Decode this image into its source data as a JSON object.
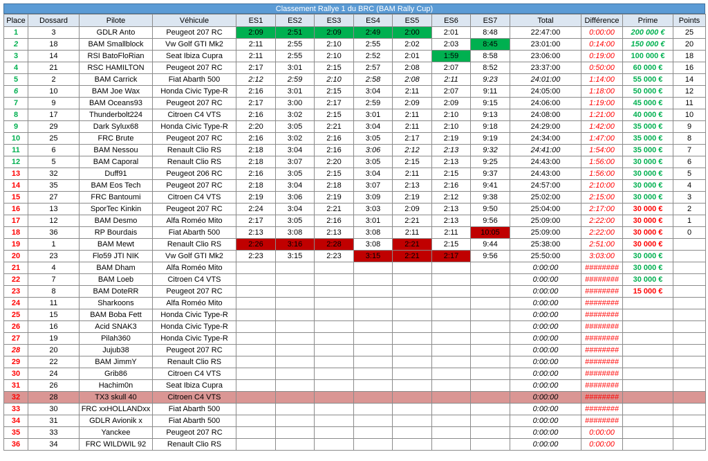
{
  "title": "Classement Rallye 1 du BRC (BAM Rally Cup)",
  "headers": [
    "Place",
    "Dossard",
    "Pilote",
    "Véhicule",
    "ES1",
    "ES2",
    "ES3",
    "ES4",
    "ES5",
    "ES6",
    "ES7",
    "Total",
    "Différence",
    "Prime",
    "Points"
  ],
  "colors": {
    "header_bg": "#dce6f1",
    "title_bg": "#5b9bd5",
    "best_green": "#00b050",
    "worst_red": "#c00000",
    "highlight_row": "#da9694",
    "place_green": "#00b050",
    "place_red": "#ff0000",
    "prime_green": "#00b050",
    "prime_red": "#ff0000"
  },
  "rows": [
    [
      "1",
      "3",
      "GDLR Anto",
      "Peugeot 207 RC",
      "2:09",
      "2:51",
      "2:09",
      "2:49",
      "2:00",
      "2:01",
      "8:48",
      "22:47:00",
      "0:00:00",
      "200 000 €",
      "25"
    ],
    [
      "2",
      "18",
      "BAM Smallblock",
      "Vw Golf GTI Mk2",
      "2:11",
      "2:55",
      "2:10",
      "2:55",
      "2:02",
      "2:03",
      "8:45",
      "23:01:00",
      "0:14:00",
      "150 000 €",
      "20"
    ],
    [
      "3",
      "14",
      "RSI BatoFloRian",
      "Seat Ibiza Cupra",
      "2:11",
      "2:55",
      "2:10",
      "2:52",
      "2:01",
      "1:59",
      "8:58",
      "23:06:00",
      "0:19:00",
      "100 000 €",
      "18"
    ],
    [
      "4",
      "21",
      "RSC HAMILTON",
      "Peugeot 207 RC",
      "2:17",
      "3:01",
      "2:15",
      "2:57",
      "2:08",
      "2:07",
      "8:52",
      "23:37:00",
      "0:50:00",
      "60 000 €",
      "16"
    ],
    [
      "5",
      "2",
      "BAM Carrick",
      "Fiat Abarth 500",
      "2:12",
      "2:59",
      "2:10",
      "2:58",
      "2:08",
      "2:11",
      "9:23",
      "24:01:00",
      "1:14:00",
      "55 000 €",
      "14"
    ],
    [
      "6",
      "10",
      "BAM Joe Wax",
      "Honda Civic Type-R",
      "2:16",
      "3:01",
      "2:15",
      "3:04",
      "2:11",
      "2:07",
      "9:11",
      "24:05:00",
      "1:18:00",
      "50 000 €",
      "12"
    ],
    [
      "7",
      "9",
      "BAM Oceans93",
      "Peugeot 207 RC",
      "2:17",
      "3:00",
      "2:17",
      "2:59",
      "2:09",
      "2:09",
      "9:15",
      "24:06:00",
      "1:19:00",
      "45 000 €",
      "11"
    ],
    [
      "8",
      "17",
      "Thunderbolt224",
      "Citroen C4 VTS",
      "2:16",
      "3:02",
      "2:15",
      "3:01",
      "2:11",
      "2:10",
      "9:13",
      "24:08:00",
      "1:21:00",
      "40 000 €",
      "10"
    ],
    [
      "9",
      "29",
      "Dark Sylux68",
      "Honda Civic Type-R",
      "2:20",
      "3:05",
      "2:21",
      "3:04",
      "2:11",
      "2:10",
      "9:18",
      "24:29:00",
      "1:42:00",
      "35 000 €",
      "9"
    ],
    [
      "10",
      "25",
      "FRC Brute",
      "Peugeot 207 RC",
      "2:16",
      "3:02",
      "2:16",
      "3:05",
      "2:17",
      "2:19",
      "9:19",
      "24:34:00",
      "1:47:00",
      "35 000 €",
      "8"
    ],
    [
      "11",
      "6",
      "BAM Nessou",
      "Renault Clio RS",
      "2:18",
      "3:04",
      "2:16",
      "3:06",
      "2:12",
      "2:13",
      "9:32",
      "24:41:00",
      "1:54:00",
      "35 000 €",
      "7"
    ],
    [
      "12",
      "5",
      "BAM Caporal",
      "Renault Clio RS",
      "2:18",
      "3:07",
      "2:20",
      "3:05",
      "2:15",
      "2:13",
      "9:25",
      "24:43:00",
      "1:56:00",
      "30 000 €",
      "6"
    ],
    [
      "13",
      "32",
      "Duff91",
      "Peugeot 206 RC",
      "2:16",
      "3:05",
      "2:15",
      "3:04",
      "2:11",
      "2:15",
      "9:37",
      "24:43:00",
      "1:56:00",
      "30 000 €",
      "5"
    ],
    [
      "14",
      "35",
      "BAM Eos Tech",
      "Peugeot 207 RC",
      "2:18",
      "3:04",
      "2:18",
      "3:07",
      "2:13",
      "2:16",
      "9:41",
      "24:57:00",
      "2:10:00",
      "30 000 €",
      "4"
    ],
    [
      "15",
      "27",
      "FRC Bantoumi",
      "Citroen C4 VTS",
      "2:19",
      "3:06",
      "2:19",
      "3:09",
      "2:19",
      "2:12",
      "9:38",
      "25:02:00",
      "2:15:00",
      "30 000 €",
      "3"
    ],
    [
      "16",
      "13",
      "SporTec Kinkin",
      "Peugeot 207 RC",
      "2:24",
      "3:04",
      "2:21",
      "3:03",
      "2:09",
      "2:13",
      "9:50",
      "25:04:00",
      "2:17:00",
      "30 000 €",
      "2"
    ],
    [
      "17",
      "12",
      "BAM Desmo",
      "Alfa Roméo Mito",
      "2:17",
      "3:05",
      "2:16",
      "3:01",
      "2:21",
      "2:13",
      "9:56",
      "25:09:00",
      "2:22:00",
      "30 000 €",
      "1"
    ],
    [
      "18",
      "36",
      "RP Bourdais",
      "Fiat Abarth 500",
      "2:13",
      "3:08",
      "2:13",
      "3:08",
      "2:11",
      "2:11",
      "10:05",
      "25:09:00",
      "2:22:00",
      "30 000 €",
      "0"
    ],
    [
      "19",
      "1",
      "BAM Mewt",
      "Renault Clio RS",
      "2:26",
      "3:16",
      "2:28",
      "3:08",
      "2:21",
      "2:15",
      "9:44",
      "25:38:00",
      "2:51:00",
      "30 000 €",
      ""
    ],
    [
      "20",
      "23",
      "Flo59 JTI NIK",
      "Vw Golf GTI Mk2",
      "2:23",
      "3:15",
      "2:23",
      "3:15",
      "2:21",
      "2:17",
      "9:56",
      "25:50:00",
      "3:03:00",
      "30 000 €",
      ""
    ],
    [
      "21",
      "4",
      "BAM Dham",
      "Alfa Roméo Mito",
      "",
      "",
      "",
      "",
      "",
      "",
      "",
      "0:00:00",
      "########",
      "30 000 €",
      ""
    ],
    [
      "22",
      "7",
      "BAM Loeb",
      "Citroen C4 VTS",
      "",
      "",
      "",
      "",
      "",
      "",
      "",
      "0:00:00",
      "########",
      "30 000 €",
      ""
    ],
    [
      "23",
      "8",
      "BAM DoteRR",
      "Peugeot 207 RC",
      "",
      "",
      "",
      "",
      "",
      "",
      "",
      "0:00:00",
      "########",
      "15 000 €",
      ""
    ],
    [
      "24",
      "11",
      "Sharkoons",
      "Alfa Roméo Mito",
      "",
      "",
      "",
      "",
      "",
      "",
      "",
      "0:00:00",
      "########",
      "",
      ""
    ],
    [
      "25",
      "15",
      "BAM Boba Fett",
      "Honda Civic Type-R",
      "",
      "",
      "",
      "",
      "",
      "",
      "",
      "0:00:00",
      "########",
      "",
      ""
    ],
    [
      "26",
      "16",
      "Acid SNAK3",
      "Honda Civic Type-R",
      "",
      "",
      "",
      "",
      "",
      "",
      "",
      "0:00:00",
      "########",
      "",
      ""
    ],
    [
      "27",
      "19",
      "Pilah360",
      "Honda Civic Type-R",
      "",
      "",
      "",
      "",
      "",
      "",
      "",
      "0:00:00",
      "########",
      "",
      ""
    ],
    [
      "28",
      "20",
      "Jujub38",
      "Peugeot 207 RC",
      "",
      "",
      "",
      "",
      "",
      "",
      "",
      "0:00:00",
      "########",
      "",
      ""
    ],
    [
      "29",
      "22",
      "BAM JimmY",
      "Renault Clio RS",
      "",
      "",
      "",
      "",
      "",
      "",
      "",
      "0:00:00",
      "########",
      "",
      ""
    ],
    [
      "30",
      "24",
      "Grib86",
      "Citroen C4 VTS",
      "",
      "",
      "",
      "",
      "",
      "",
      "",
      "0:00:00",
      "########",
      "",
      ""
    ],
    [
      "31",
      "26",
      "Hachim0n",
      "Seat Ibiza Cupra",
      "",
      "",
      "",
      "",
      "",
      "",
      "",
      "0:00:00",
      "########",
      "",
      ""
    ],
    [
      "32",
      "28",
      "TX3 skull 40",
      "Citroen C4 VTS",
      "",
      "",
      "",
      "",
      "",
      "",
      "",
      "0:00:00",
      "########",
      "",
      ""
    ],
    [
      "33",
      "30",
      "FRC xxHOLLANDxx",
      "Fiat Abarth 500",
      "",
      "",
      "",
      "",
      "",
      "",
      "",
      "0:00:00",
      "########",
      "",
      ""
    ],
    [
      "34",
      "31",
      "GDLR Avionik x",
      "Fiat Abarth 500",
      "",
      "",
      "",
      "",
      "",
      "",
      "",
      "0:00:00",
      "########",
      "",
      ""
    ],
    [
      "35",
      "33",
      "Yanckee",
      "Peugeot 207 RC",
      "",
      "",
      "",
      "",
      "",
      "",
      "",
      "0:00:00",
      "0:00:00",
      "",
      ""
    ],
    [
      "36",
      "34",
      "FRC WILDWIL 92",
      "Renault Clio RS",
      "",
      "",
      "",
      "",
      "",
      "",
      "",
      "0:00:00",
      "0:00:00",
      "",
      ""
    ]
  ],
  "best_cells": [
    [
      0,
      4
    ],
    [
      0,
      5
    ],
    [
      0,
      6
    ],
    [
      0,
      7
    ],
    [
      0,
      8
    ],
    [
      1,
      10
    ],
    [
      2,
      9
    ]
  ],
  "worst_cells": [
    [
      17,
      10
    ],
    [
      18,
      4
    ],
    [
      18,
      5
    ],
    [
      18,
      6
    ],
    [
      18,
      8
    ],
    [
      19,
      7
    ],
    [
      19,
      8
    ],
    [
      19,
      9
    ]
  ],
  "italic_cells": [
    [
      1,
      0
    ],
    [
      4,
      4
    ],
    [
      4,
      5
    ],
    [
      4,
      6
    ],
    [
      4,
      7
    ],
    [
      4,
      8
    ],
    [
      4,
      9
    ],
    [
      4,
      10
    ],
    [
      4,
      11
    ],
    [
      5,
      0
    ],
    [
      10,
      7
    ],
    [
      10,
      8
    ],
    [
      10,
      9
    ],
    [
      10,
      10
    ],
    [
      10,
      11
    ],
    [
      27,
      0
    ],
    [
      31,
      11
    ]
  ],
  "highlight_row": 31
}
